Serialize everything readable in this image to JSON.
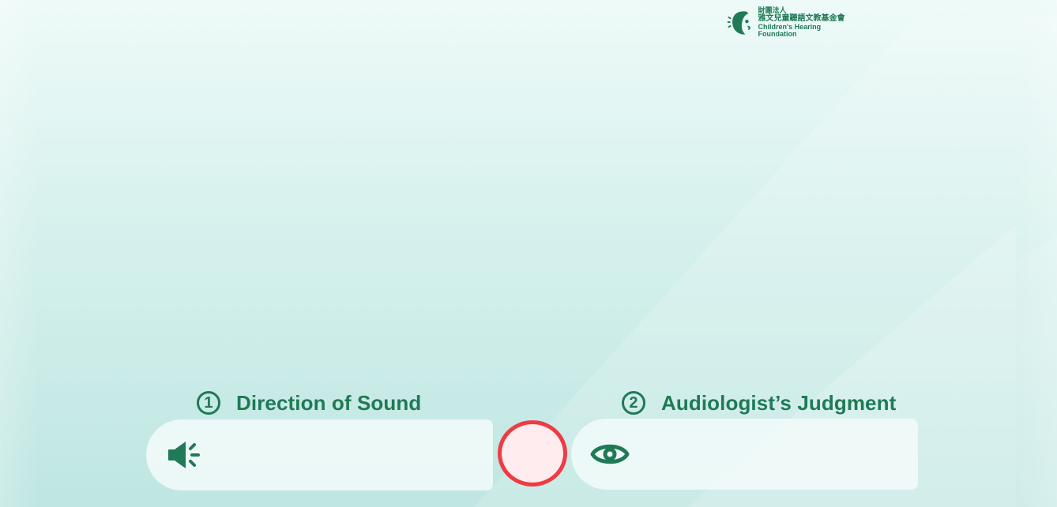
{
  "logo": {
    "line1": "財團法人",
    "line2": "雅文兒童聽語文教基金會",
    "line3": "Children's Hearing Foundation"
  },
  "steps": [
    {
      "number": "1",
      "title": "Direction of Sound"
    },
    {
      "number": "2",
      "title": "Audiologist’s Judgment"
    }
  ],
  "icons": {
    "sound": "speaker-icon",
    "judgment": "eye-icon"
  },
  "colors": {
    "brand_green": "#1f7a55",
    "record_red": "#ee3b44",
    "panel_bg": "#f0faf8"
  }
}
